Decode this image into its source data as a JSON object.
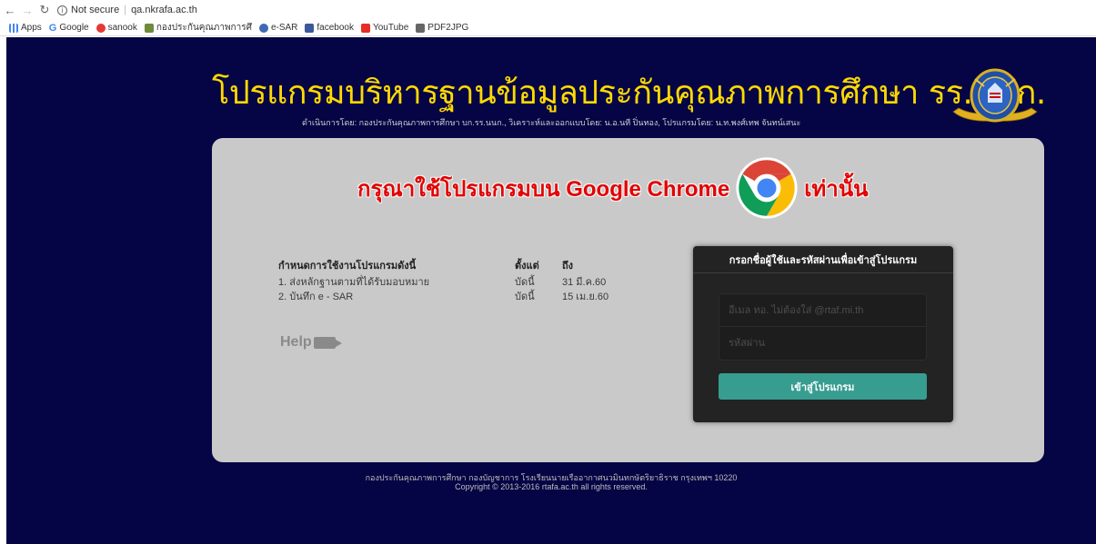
{
  "browser": {
    "security_label": "Not secure",
    "url": "qa.nkrafa.ac.th",
    "bookmarks": [
      {
        "label": "Apps",
        "icon": "apps-grid-icon"
      },
      {
        "label": "Google",
        "icon": "google-icon"
      },
      {
        "label": "sanook",
        "icon": "sanook-icon"
      },
      {
        "label": "กองประกันคุณภาพการศึ",
        "icon": "qa-icon"
      },
      {
        "label": "e-SAR",
        "icon": "esar-icon"
      },
      {
        "label": "facebook",
        "icon": "facebook-icon"
      },
      {
        "label": "YouTube",
        "icon": "youtube-icon"
      },
      {
        "label": "PDF2JPG",
        "icon": "pdf2jpg-icon"
      }
    ]
  },
  "header": {
    "title": "โปรแกรมบริหารฐานข้อมูลประกันคุณภาพการศึกษา รร.นนก.",
    "subtitle": "ดำเนินการโดย: กองประกันคุณภาพการศึกษา บก.รร.นนก., วิเคราะห์และออกแบบโดย: น.อ.นที ปิ่นทอง, โปรแกรมโดย: น.ท.พงศ์เทพ จันทน์เสนะ"
  },
  "warning": {
    "before": "กรุณาใช้โปรแกรมบน Google Chrome",
    "after": "เท่านั้น"
  },
  "schedule": {
    "headers": [
      "กำหนดการใช้งานโปรแกรมดังนี้",
      "ตั้งแต่",
      "ถึง"
    ],
    "rows": [
      [
        "1. ส่งหลักฐานตามที่ได้รับมอบหมาย",
        "บัดนี้",
        "31 มี.ค.60"
      ],
      [
        "2. บันทึก e - SAR",
        "บัดนี้",
        "15 เม.ย.60"
      ]
    ]
  },
  "help": {
    "label": "Help"
  },
  "login": {
    "heading": "กรอกชื่อผู้ใช้และรหัสผ่านเพื่อเข้าสู่โปรแกรม",
    "username_placeholder": "อีเมล ทอ. ไม่ต้องใส่ @rtaf.mi.th",
    "password_placeholder": "รหัสผ่าน",
    "submit_label": "เข้าสู่โปรแกรม"
  },
  "footer": {
    "line1": "กองประกันคุณภาพการศึกษา กองบัญชาการ โรงเรียนนายเรืออากาศนวมินทกษัตริยาธิราช กรุงเทพฯ 10220",
    "line2": "Copyright © 2013-2016 rtafa.ac.th all rights reserved."
  },
  "colors": {
    "page_background": "#050545",
    "title": "#ffd900",
    "warning": "#e30000",
    "login_button": "#379d90"
  }
}
